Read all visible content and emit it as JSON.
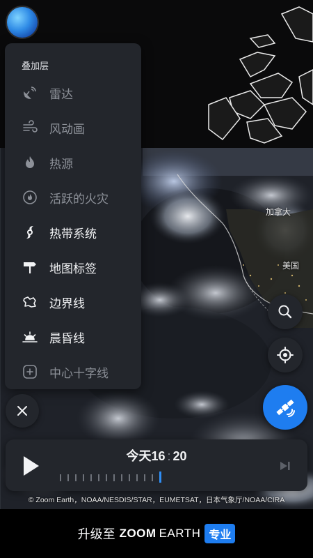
{
  "map": {
    "labels": {
      "canada": "加拿大",
      "usa": "美国"
    }
  },
  "overlay_menu": {
    "heading": "叠加层",
    "items": [
      {
        "label": "雷达",
        "icon": "radar-dish-icon",
        "state": "off"
      },
      {
        "label": "风动画",
        "icon": "wind-icon",
        "state": "off"
      },
      {
        "label": "热源",
        "icon": "flame-icon",
        "state": "off"
      },
      {
        "label": "活跃的火灾",
        "icon": "fire-circle-icon",
        "state": "off"
      },
      {
        "label": "热带系统",
        "icon": "hurricane-icon",
        "state": "on"
      },
      {
        "label": "地图标签",
        "icon": "signpost-icon",
        "state": "on"
      },
      {
        "label": "边界线",
        "icon": "border-map-icon",
        "state": "on"
      },
      {
        "label": "晨昏线",
        "icon": "sunrise-icon",
        "state": "on"
      },
      {
        "label": "中心十字线",
        "icon": "crosshair-plus-icon",
        "state": "off"
      }
    ]
  },
  "timeline": {
    "day": "今天",
    "hour": "16",
    "separator": ":",
    "minute": "20",
    "tick_count": 14,
    "current_tick_index": 13
  },
  "attribution": "© Zoom Earth，NOAA/NESDIS/STAR，EUMETSAT，日本气象厅/NOAA/CIRA",
  "upgrade": {
    "prefix": "升级至",
    "brand_bold": "ZOOM",
    "brand_light": "EARTH",
    "badge": "专业"
  },
  "colors": {
    "accent": "#1e7df0",
    "panel": "#23262c",
    "tick_current": "#2f8ef5"
  }
}
